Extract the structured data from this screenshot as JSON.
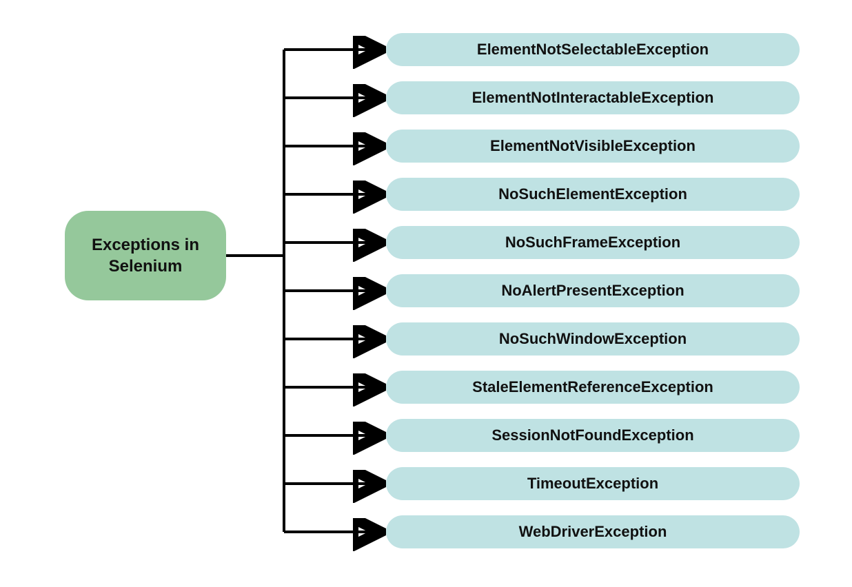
{
  "root": {
    "label": "Exceptions in Selenium"
  },
  "children": [
    {
      "label": "ElementNotSelectableException"
    },
    {
      "label": "ElementNotInteractableException"
    },
    {
      "label": "ElementNotVisibleException"
    },
    {
      "label": "NoSuchElementException"
    },
    {
      "label": "NoSuchFrameException"
    },
    {
      "label": "NoAlertPresentException"
    },
    {
      "label": "NoSuchWindowException"
    },
    {
      "label": "StaleElementReferenceException"
    },
    {
      "label": "SessionNotFoundException"
    },
    {
      "label": "TimeoutException"
    },
    {
      "label": "WebDriverException"
    }
  ],
  "layout": {
    "childStartY": 48,
    "childGap": 70,
    "childHeight": 48,
    "rootRightX": 328,
    "trunkX": 412,
    "arrowEndX": 548,
    "rootCenterY": 371
  }
}
